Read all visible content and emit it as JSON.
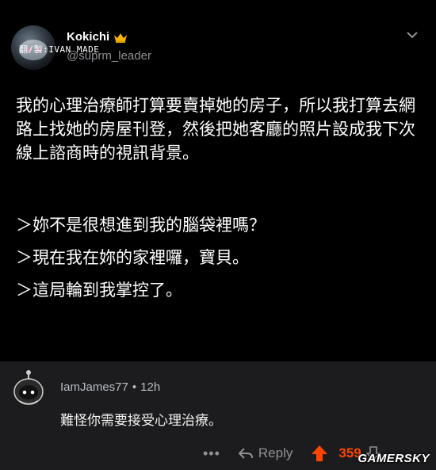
{
  "post": {
    "author_name": "Kokichi",
    "author_handle": "@suprm_leader",
    "translator_credit": "翻/製:IVAN MADE",
    "body": "我的心理治療師打算要賣掉她的房子，所以我打算去網路上找她的房屋刊登，然後把她客廳的照片設成我下次線上諮商時的視訊背景。",
    "quotes": [
      "＞妳不是很想進到我的腦袋裡嗎？",
      "＞現在我在妳的家裡囉，寶貝。",
      "＞這局輪到我掌控了。"
    ]
  },
  "comment": {
    "username": "IamJames77",
    "separator": "•",
    "time": "12h",
    "text": "難怪你需要接受心理治療。",
    "more": "•••",
    "reply_label": "Reply",
    "upvotes": "359"
  },
  "watermark": "GAMERSKY",
  "colors": {
    "background": "#000000",
    "comment_bg": "#1c1c1e",
    "muted_text": "#8e9196",
    "upvote_orange": "#ff4500"
  }
}
